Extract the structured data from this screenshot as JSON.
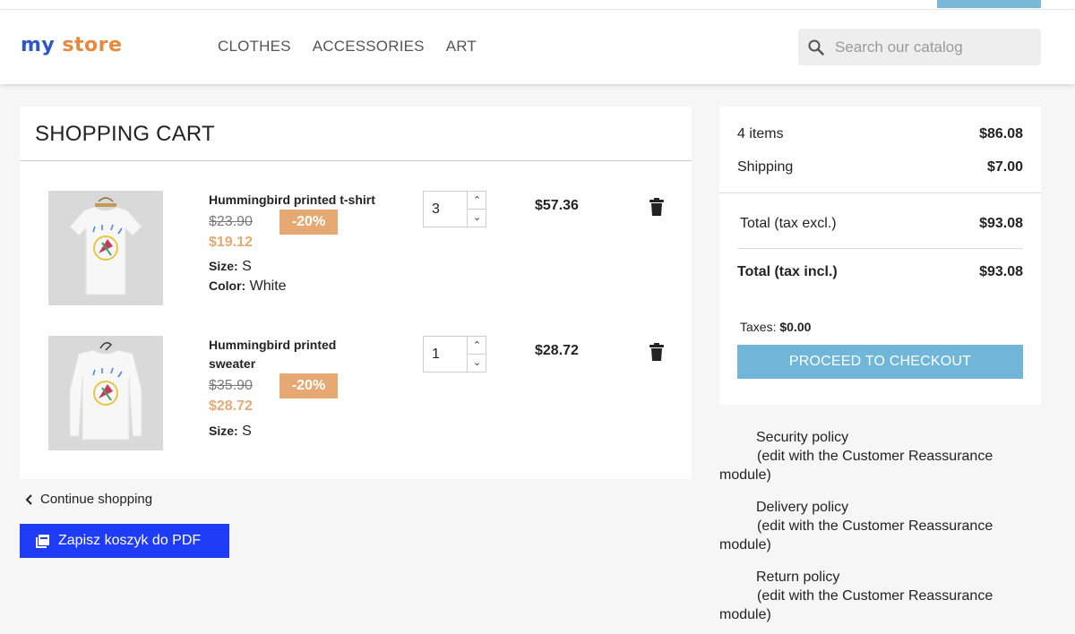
{
  "colors": {
    "accent_blue": "#6fb6d9",
    "discount_orange": "#e6a973",
    "pdf_button_blue": "#1e3cf6"
  },
  "logo": {
    "text_part1": "my",
    "text_part2": "store"
  },
  "nav": {
    "items": [
      "CLOTHES",
      "ACCESSORIES",
      "ART"
    ]
  },
  "search": {
    "placeholder": "Search our catalog",
    "value": ""
  },
  "cart": {
    "title": "SHOPPING CART",
    "items": [
      {
        "name": "Hummingbird printed t-shirt",
        "old_price": "$23.90",
        "discount": "-20%",
        "price": "$19.12",
        "attributes": [
          {
            "label": "Size:",
            "value": "S"
          },
          {
            "label": "Color:",
            "value": "White"
          }
        ],
        "quantity": "3",
        "line_total": "$57.36"
      },
      {
        "name": "Hummingbird printed sweater",
        "old_price": "$35.90",
        "discount": "-20%",
        "price": "$28.72",
        "attributes": [
          {
            "label": "Size:",
            "value": "S"
          }
        ],
        "quantity": "1",
        "line_total": "$28.72"
      }
    ]
  },
  "continue_shopping": "Continue shopping",
  "pdf_button": "Zapisz koszyk do PDF",
  "summary": {
    "items_label": "4 items",
    "items_value": "$86.08",
    "shipping_label": "Shipping",
    "shipping_value": "$7.00",
    "total_excl_label": "Total (tax excl.)",
    "total_excl_value": "$93.08",
    "total_incl_label": "Total (tax incl.)",
    "total_incl_value": "$93.08",
    "taxes_label": "Taxes:",
    "taxes_value": "$0.00",
    "checkout_label": "PROCEED TO CHECKOUT"
  },
  "reassurance": [
    {
      "title": "Security policy",
      "desc_1": "(edit with the Customer Reassurance",
      "desc_2": "module)"
    },
    {
      "title": "Delivery policy",
      "desc_1": "(edit with the Customer Reassurance",
      "desc_2": "module)"
    },
    {
      "title": "Return policy",
      "desc_1": "(edit with the Customer Reassurance",
      "desc_2": "module)"
    }
  ]
}
